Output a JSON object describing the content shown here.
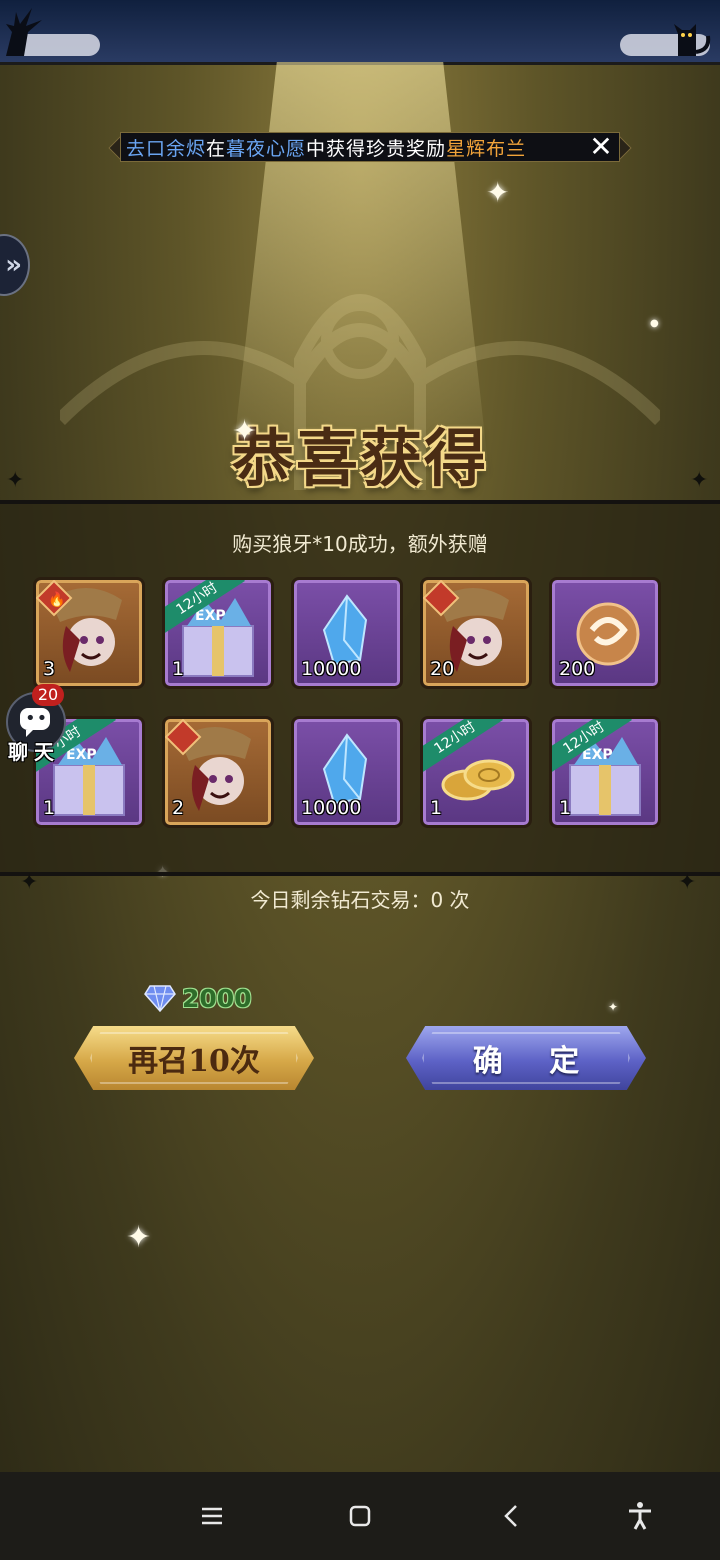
{
  "marquee": {
    "segments": [
      {
        "text": "去口余烬",
        "color": "blue"
      },
      {
        "text": "在",
        "color": "white"
      },
      {
        "text": "暮夜心愿",
        "color": "blue"
      },
      {
        "text": "中获得珍贵奖励",
        "color": "white"
      },
      {
        "text": "星辉布兰",
        "color": "orange"
      }
    ],
    "close_icon": "close-icon"
  },
  "side_panel": {
    "icon": "double-chevron-right-icon"
  },
  "title": "恭喜获得",
  "purchase_message": "购买狼牙*10成功，额外获赠",
  "rewards": [
    {
      "icon": "hero-fragment-icon",
      "count": "3",
      "frame": "orange",
      "ribbon": ""
    },
    {
      "icon": "exp-gift-box-icon",
      "count": "1",
      "frame": "purple",
      "ribbon": "12小时"
    },
    {
      "icon": "blue-crystal-icon",
      "count": "10000",
      "frame": "purple",
      "ribbon": ""
    },
    {
      "icon": "hero-fragment-icon",
      "count": "20",
      "frame": "orange",
      "ribbon": ""
    },
    {
      "icon": "swirl-orb-icon",
      "count": "200",
      "frame": "purple",
      "ribbon": ""
    },
    {
      "icon": "exp-gift-box-icon",
      "count": "1",
      "frame": "purple",
      "ribbon": "小时"
    },
    {
      "icon": "hero-fragment-icon",
      "count": "2",
      "frame": "orange",
      "ribbon": ""
    },
    {
      "icon": "blue-crystal-icon",
      "count": "10000",
      "frame": "purple",
      "ribbon": ""
    },
    {
      "icon": "gold-coins-icon",
      "count": "1",
      "frame": "purple",
      "ribbon": "12小时"
    },
    {
      "icon": "exp-gift-box-icon",
      "count": "1",
      "frame": "purple",
      "ribbon": "12小时"
    }
  ],
  "chat": {
    "badge": "20",
    "label": "聊天"
  },
  "daily_trade": "今日剩余钻石交易：0 次",
  "cost": {
    "icon": "diamond-icon",
    "value": "2000"
  },
  "buttons": {
    "summon_again": "再召10次",
    "confirm": "确 定"
  },
  "colors": {
    "blue": "#6aa5f2",
    "orange": "#f2a43a",
    "white": "#ffffff"
  },
  "nav_bar": [
    "menu-icon",
    "home-icon",
    "back-icon",
    "accessibility-icon"
  ]
}
